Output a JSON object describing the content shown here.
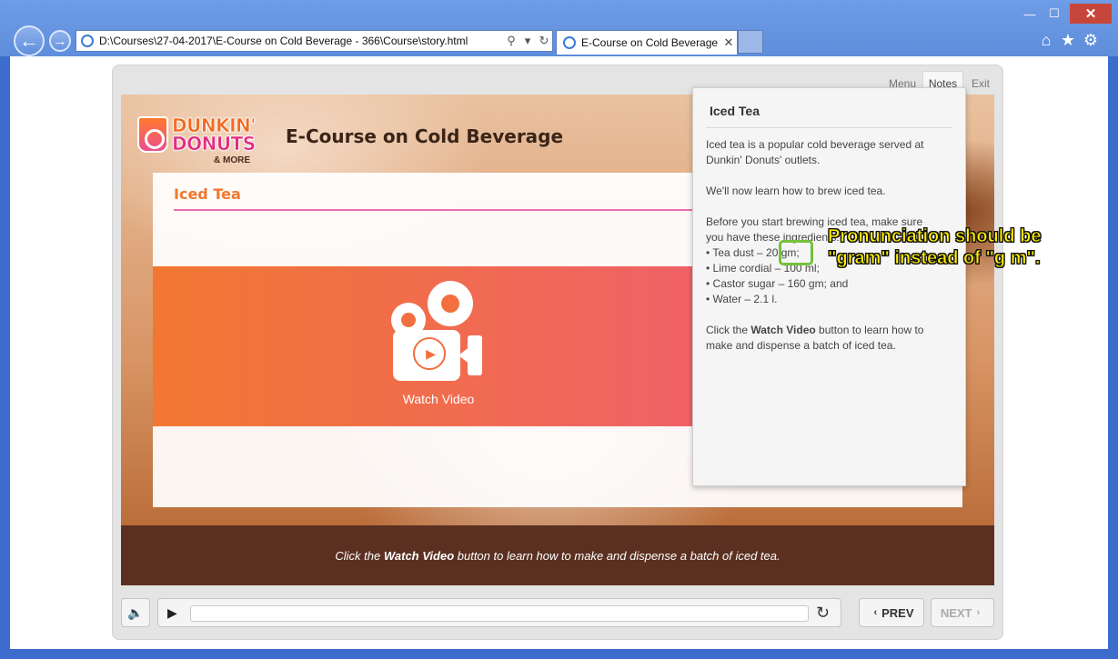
{
  "browser": {
    "address": "D:\\Courses\\27-04-2017\\E-Course on Cold Beverage - 366\\Course\\story.html",
    "tab_title": "E-Course on Cold Beverage",
    "tab_close": "✕",
    "back": "←",
    "forward": "→",
    "search_glyph": "⚲",
    "dropdown_glyph": "▾",
    "refresh_glyph": "↻",
    "window_min": "—",
    "window_max": "☐",
    "window_close": "✕",
    "home_glyph": "⌂",
    "favorites_glyph": "★",
    "settings_glyph": "⚙"
  },
  "player": {
    "top_tabs": {
      "menu": "Menu",
      "notes": "Notes",
      "exit": "Exit"
    }
  },
  "slide": {
    "logo": {
      "line1": "DUNKIN'",
      "line2": "DONUTS",
      "tagline": "& MORE"
    },
    "course_title": "E-Course on Cold Beverage",
    "section_title": "Iced Tea",
    "watch_video_label": "Watch Video",
    "caption": {
      "before": "Click the ",
      "bold": "Watch Video",
      "after": " button to learn how to make and dispense a batch of iced tea."
    }
  },
  "notes": {
    "heading": "Iced Tea",
    "para1": "Iced tea is a popular cold beverage served at Dunkin' Donuts' outlets.",
    "para2": "We'll now learn how to brew iced tea.",
    "para3_intro": "Before you start brewing iced tea, make sure you have these ingredients:",
    "ingredients": [
      "• Tea dust – 20 gm;",
      "• Lime cordial – 100 ml;",
      "• Castor sugar – 160 gm; and",
      "• Water – 2.1 l."
    ],
    "para4_before": "Click the ",
    "para4_bold": "Watch Video",
    "para4_after": " button to learn how to make and dispense a batch of iced tea."
  },
  "annotation": {
    "text_line1": "Pronunciation should be",
    "text_line2": "\"gram\" instead of \"g m\"."
  },
  "controls": {
    "volume_glyph": "🔈",
    "play_glyph": "▶",
    "replay_glyph": "↻",
    "progress_fraction": 0,
    "prev_label": "PREV",
    "next_label": "NEXT",
    "prev_arrow": "‹",
    "next_arrow": "›"
  },
  "colors": {
    "accent_orange": "#f0782f",
    "accent_pink": "#ec6fae",
    "caption_bg": "#5b3021",
    "annotation_yellow": "#ffee00",
    "highlight_green": "#74c23a"
  }
}
